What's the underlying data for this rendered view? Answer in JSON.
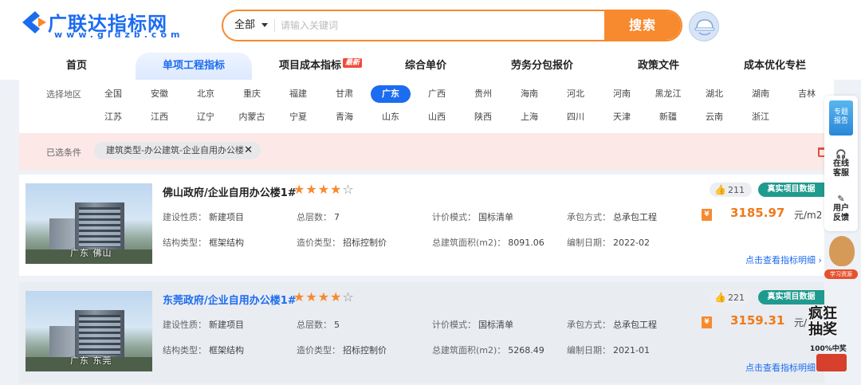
{
  "logo": {
    "title": "广联达指标网",
    "url": "www.gldzb.com"
  },
  "search": {
    "scope": "全部",
    "placeholder": "请输入关键词",
    "button": "搜索"
  },
  "nav": [
    {
      "label": "首页"
    },
    {
      "label": "单项工程指标",
      "active": true
    },
    {
      "label": "项目成本指标",
      "badge": "最新"
    },
    {
      "label": "综合单价"
    },
    {
      "label": "劳务分包报价"
    },
    {
      "label": "政策文件"
    },
    {
      "label": "成本优化专栏"
    }
  ],
  "region": {
    "label": "选择地区",
    "row1": [
      "全国",
      "安徽",
      "北京",
      "重庆",
      "福建",
      "甘肃",
      "广东",
      "广西",
      "贵州",
      "海南",
      "河北",
      "河南",
      "黑龙江",
      "湖北",
      "湖南",
      "吉林"
    ],
    "row2": [
      "江苏",
      "江西",
      "辽宁",
      "内蒙古",
      "宁夏",
      "青海",
      "山东",
      "山西",
      "陕西",
      "上海",
      "四川",
      "天津",
      "新疆",
      "云南",
      "浙江"
    ],
    "selected": "广东"
  },
  "conditions": {
    "label": "已选条件",
    "tag": "建筑类型-办公建筑-企业自用办公楼",
    "remove": "✕"
  },
  "results": [
    {
      "name": "佛山政府/企业自用办公楼1#",
      "rating": 4,
      "stars_on": "★★★★",
      "stars_off": "☆",
      "thumb_caption": "广东 佛山",
      "fields": {
        "nature_label": "建设性质：",
        "nature": "新建项目",
        "floors_label": "总层数：",
        "floors": "7",
        "pricing_label": "计价模式：",
        "pricing": "国标清单",
        "contract_label": "承包方式：",
        "contract": "总承包工程",
        "structure_label": "结构类型：",
        "structure": "框架结构",
        "cost_label": "造价类型：",
        "cost": "招标控制价",
        "area_label": "总建筑面积(m2)：",
        "area": "8091.06",
        "date_label": "编制日期：",
        "date": "2022-02"
      },
      "likes": "211",
      "tag": "真实项目数据",
      "price": "3185.97",
      "unit": "元/m2",
      "detail": "点击查看指标明细 ›"
    },
    {
      "name": "东莞政府/企业自用办公楼1#",
      "rating": 4,
      "stars_on": "★★★★",
      "stars_off": "☆",
      "thumb_caption": "广东 东莞",
      "fields": {
        "nature_label": "建设性质：",
        "nature": "新建项目",
        "floors_label": "总层数：",
        "floors": "5",
        "pricing_label": "计价模式：",
        "pricing": "国标清单",
        "contract_label": "承包方式：",
        "contract": "总承包工程",
        "structure_label": "结构类型：",
        "structure": "框架结构",
        "cost_label": "造价类型：",
        "cost": "招标控制价",
        "area_label": "总建筑面积(m2)：",
        "area": "5268.49",
        "date_label": "编制日期：",
        "date": "2021-01"
      },
      "likes": "221",
      "tag": "真实项目数据",
      "price": "3159.31",
      "unit": "元/",
      "detail": "点击查看指标明细 ›"
    }
  ],
  "sidebar": {
    "report": "专题\n报告",
    "service": "在线\n客服",
    "feedback": "用户\n反馈",
    "mascot_label": "学习资源",
    "lottery_title": "疯狂\n抽奖",
    "lottery_sub": "100%中奖"
  },
  "colors": {
    "brand_blue": "#1c6cf0",
    "accent_orange": "#f7892e",
    "tag_teal": "#1f9a8e"
  }
}
